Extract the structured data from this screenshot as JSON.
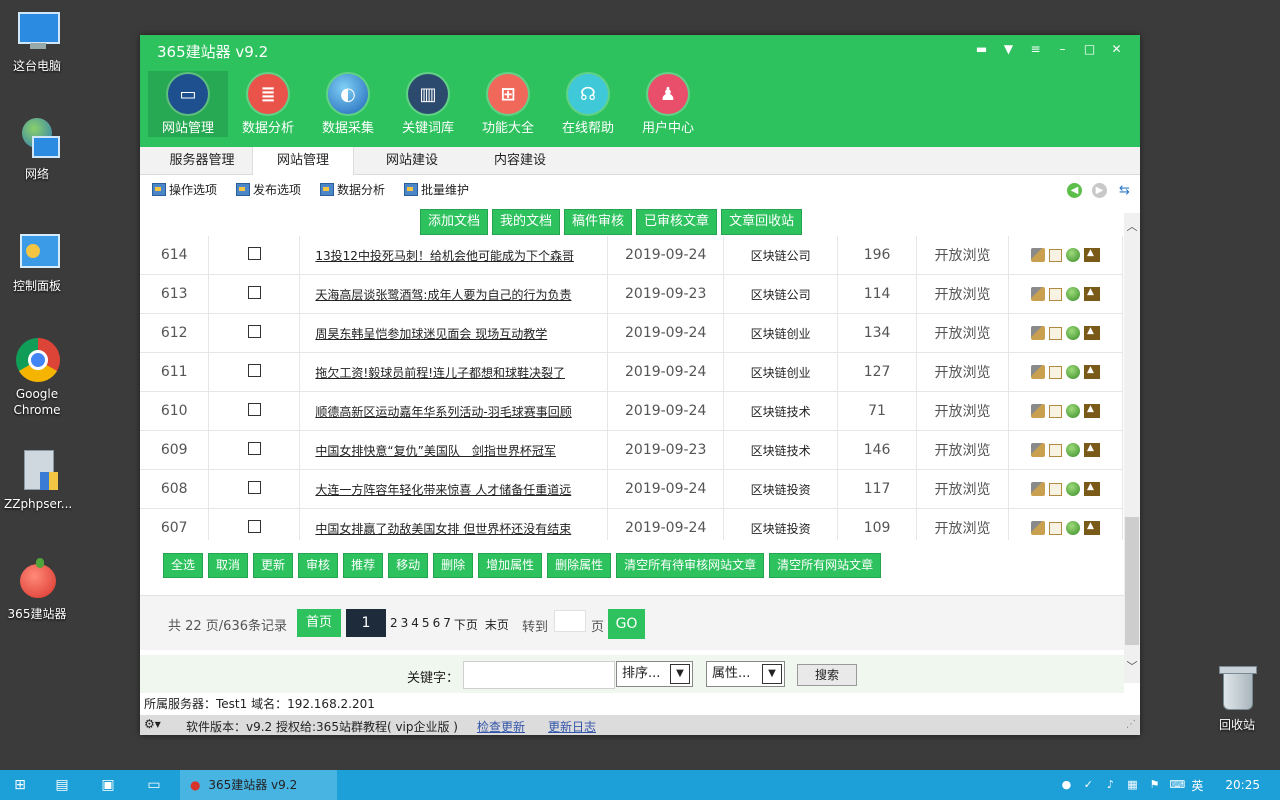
{
  "desktop": {
    "icons": [
      {
        "label": "这台电脑",
        "icon": "computer-icon"
      },
      {
        "label": "网络",
        "icon": "network-icon"
      },
      {
        "label": "控制面板",
        "icon": "control-panel-icon"
      },
      {
        "label": "Google Chrome",
        "icon": "chrome-icon"
      },
      {
        "label": "ZZphpser...",
        "icon": "installer-icon"
      },
      {
        "label": "365建站器",
        "icon": "apple-icon"
      }
    ],
    "recycle_bin": "回收站"
  },
  "window": {
    "title": "365建站器 v9.2",
    "controls": [
      "message-icon",
      "skin-icon",
      "menu-icon",
      "minimize-icon",
      "maximize-icon",
      "close-icon"
    ],
    "nav": [
      {
        "label": "网站管理",
        "icon": "monitor-icon",
        "color": "#1e4f8f",
        "active": true
      },
      {
        "label": "数据分析",
        "icon": "database-icon",
        "color": "#e9534a"
      },
      {
        "label": "数据采集",
        "icon": "globe-icon",
        "color": "#2a78c8"
      },
      {
        "label": "关键词库",
        "icon": "book-icon",
        "color": "#2c4a6e"
      },
      {
        "label": "功能大全",
        "icon": "grid-icon",
        "color": "#f0685a"
      },
      {
        "label": "在线帮助",
        "icon": "headset-icon",
        "color": "#3fc8d8"
      },
      {
        "label": "用户中心",
        "icon": "user-icon",
        "color": "#e94f6a"
      }
    ],
    "tabs": [
      "服务器管理",
      "网站管理",
      "网站建设",
      "内容建设"
    ],
    "active_tab": "网站管理",
    "toolbar": [
      "操作选项",
      "发布选项",
      "数据分析",
      "批量维护"
    ],
    "doc_buttons": [
      "添加文档",
      "我的文档",
      "稿件审核",
      "已审核文章",
      "文章回收站"
    ],
    "rows": [
      {
        "id": "614",
        "title": "13投12中投死马刺！给机会他可能成为下个森哥",
        "date": "2019-09-24",
        "category": "区块链公司",
        "views": "196",
        "status": "开放浏览"
      },
      {
        "id": "613",
        "title": "天海高层谈张鹭酒驾:成年人要为自己的行为负责",
        "date": "2019-09-23",
        "category": "区块链公司",
        "views": "114",
        "status": "开放浏览"
      },
      {
        "id": "612",
        "title": "周昊东韩呈恺参加球迷见面会 现场互动教学",
        "date": "2019-09-24",
        "category": "区块链创业",
        "views": "134",
        "status": "开放浏览"
      },
      {
        "id": "611",
        "title": "拖欠工资!毅球员前程!连儿子都想和球鞋决裂了",
        "date": "2019-09-24",
        "category": "区块链创业",
        "views": "127",
        "status": "开放浏览"
      },
      {
        "id": "610",
        "title": "顺德高新区运动嘉年华系列活动-羽毛球赛事回顾",
        "date": "2019-09-24",
        "category": "区块链技术",
        "views": "71",
        "status": "开放浏览"
      },
      {
        "id": "609",
        "title": "中国女排快意“复仇”美国队　剑指世界杯冠军",
        "date": "2019-09-23",
        "category": "区块链技术",
        "views": "146",
        "status": "开放浏览"
      },
      {
        "id": "608",
        "title": "大连一方阵容年轻化带来惊喜 人才储备任重道远",
        "date": "2019-09-24",
        "category": "区块链投资",
        "views": "117",
        "status": "开放浏览"
      },
      {
        "id": "607",
        "title": "中国女排赢了劲敌美国女排 但世界杯还没有结束",
        "date": "2019-09-24",
        "category": "区块链投资",
        "views": "109",
        "status": "开放浏览"
      }
    ],
    "actions": [
      "全选",
      "取消",
      "更新",
      "审核",
      "推荐",
      "移动",
      "删除",
      "增加属性",
      "删除属性",
      "清空所有待审核网站文章",
      "清空所有网站文章"
    ],
    "pager": {
      "info": "共 22 页/636条记录",
      "first": "首页",
      "current": "1",
      "pages": [
        "2",
        "3",
        "4",
        "5",
        "6",
        "7"
      ],
      "next": "下页",
      "last": "末页",
      "goto": "转到",
      "page_unit": "页",
      "go": "GO"
    },
    "search": {
      "label": "关键字：",
      "sort_value": "排序...",
      "attr_value": "属性...",
      "button": "搜索"
    },
    "server_info": "所属服务器：Test1 域名：192.168.2.201",
    "status": {
      "version": "软件版本：v9.2  授权给:365站群教程( vip企业版 )",
      "check_update": "检查更新",
      "update_log": "更新日志"
    }
  },
  "taskbar": {
    "app_label": "365建站器 v9.2",
    "ime": "英",
    "time": "20:25"
  }
}
